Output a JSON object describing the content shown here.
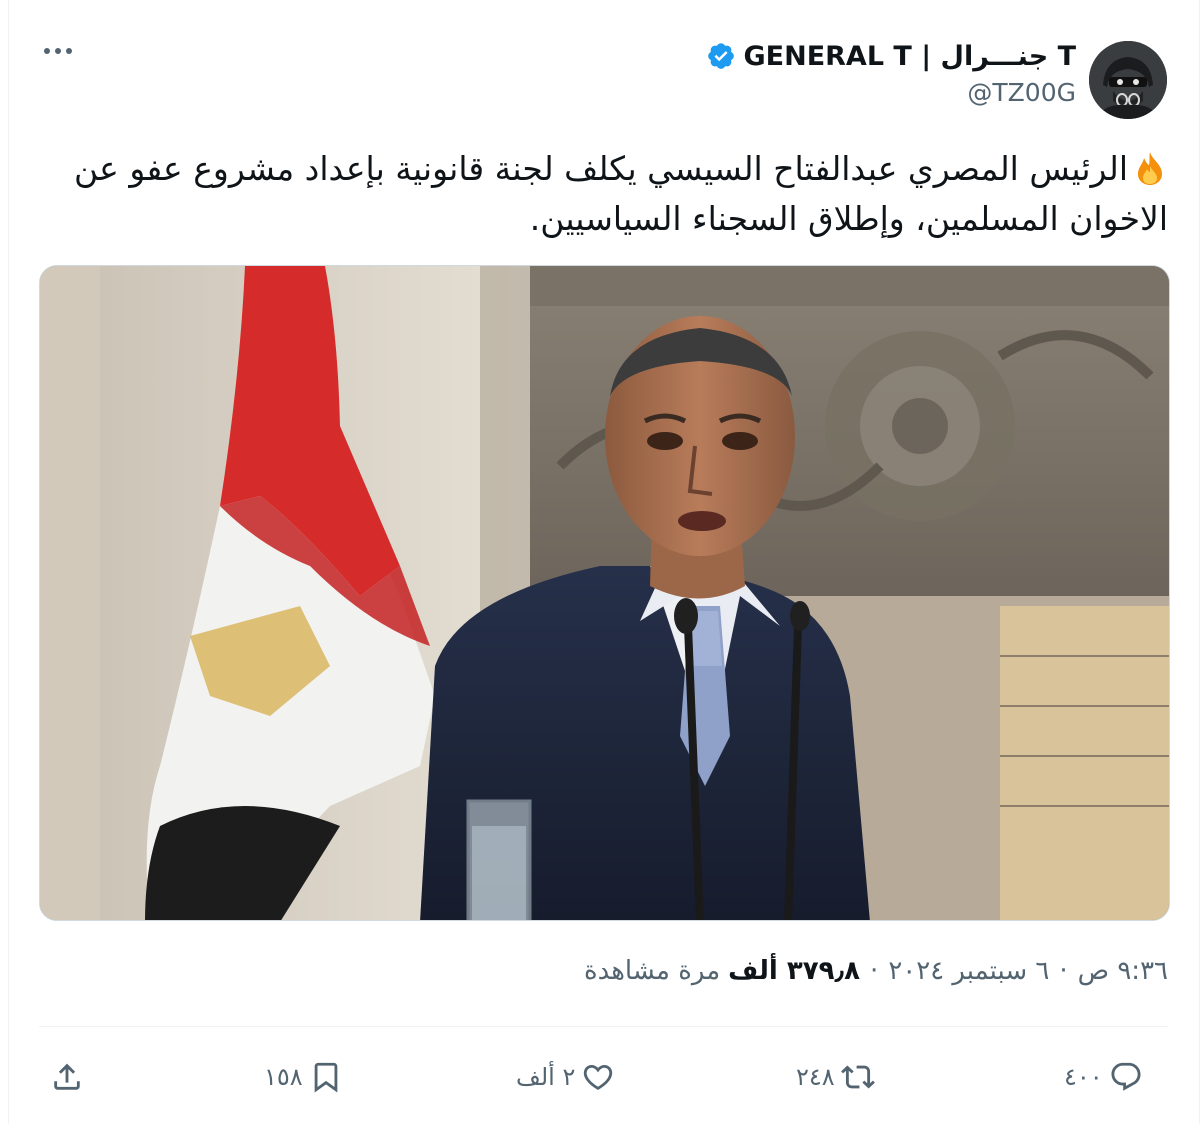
{
  "author": {
    "display_name": "GENERAL T | جنـــرال T",
    "handle": "@TZ00G",
    "verified": true
  },
  "colors": {
    "text": "#0f1419",
    "secondary": "#536471",
    "verified_blue": "#1d9bf0",
    "divider": "#eff3f4"
  },
  "icons": {
    "more": "more-horizontal-icon",
    "verified": "verified-badge-icon",
    "fire": "fire-emoji",
    "reply": "reply-icon",
    "retweet": "retweet-icon",
    "like": "heart-icon",
    "bookmark": "bookmark-icon",
    "share": "share-icon"
  },
  "tweet": {
    "text": "الرئيس المصري عبدالفتاح السيسي يكلف لجنة قانونية بإعداد مشروع عفو عن الاخوان المسلمين، وإطلاق السجناء السياسيين."
  },
  "meta": {
    "time": "٩:٣٦ ص",
    "date": "٦ سبتمبر ٢٠٢٤",
    "views_count": "٣٧٩٫٨ ألف",
    "views_label": "مرة مشاهدة",
    "separator": "·"
  },
  "actions": {
    "replies": "٤٠٠",
    "retweets": "٢٤٨",
    "likes": "٢ ألف",
    "bookmarks": "١٥٨"
  }
}
